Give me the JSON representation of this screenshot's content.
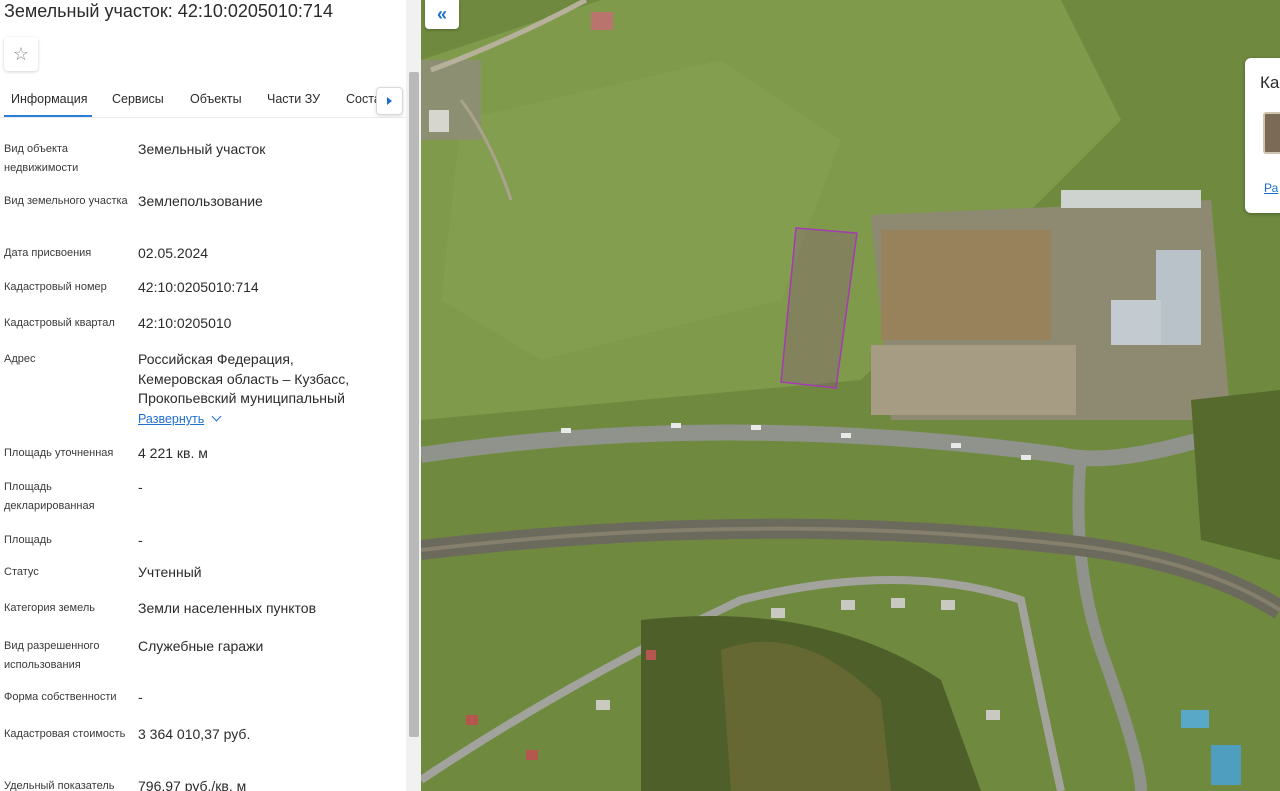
{
  "panel": {
    "title": "Земельный участок: 42:10:0205010:714",
    "tabs": [
      {
        "label": "Информация"
      },
      {
        "label": "Сервисы"
      },
      {
        "label": "Объекты"
      },
      {
        "label": "Части ЗУ"
      },
      {
        "label": "Состав"
      }
    ],
    "icons": {
      "favorite": "star-icon",
      "tabs_next": "chevron-right-icon"
    },
    "properties": [
      {
        "label": "Вид объекта недвижимости",
        "value": "Земельный участок"
      },
      {
        "label": "Вид земельного участка",
        "value": "Землепользование"
      },
      {
        "label": "Дата присвоения",
        "value": "02.05.2024"
      },
      {
        "label": "Кадастровый номер",
        "value": "42:10:0205010:714"
      },
      {
        "label": "Кадастровый квартал",
        "value": "42:10:0205010"
      },
      {
        "label": "Адрес",
        "value": "Российская Федерация, Кемеровская область – Кузбасс, Прокопьевский муниципальный"
      },
      {
        "label": "Площадь уточненная",
        "value": "4 221 кв. м"
      },
      {
        "label": "Площадь декларированная",
        "value": "-"
      },
      {
        "label": "Площадь",
        "value": "-"
      },
      {
        "label": "Статус",
        "value": "Учтенный"
      },
      {
        "label": "Категория земель",
        "value": "Земли населенных пунктов"
      },
      {
        "label": "Вид разрешенного использования",
        "value": "Служебные гаражи"
      },
      {
        "label": "Форма собственности",
        "value": "-"
      },
      {
        "label": "Кадастровая стоимость",
        "value": "3 364 010,37 руб."
      },
      {
        "label": "Удельный показатель",
        "value": "796,97 руб./кв. м"
      }
    ],
    "expand_label": "Развернуть"
  },
  "map": {
    "collapse_icon": "double-chevron-left-icon",
    "collapse_glyph": "«",
    "info_card": {
      "title": "Ка",
      "link": "Ра"
    },
    "colors": {
      "parcel_outline": "#a43bb4",
      "grass": "#6f8a3e",
      "road": "#8f938c"
    }
  }
}
